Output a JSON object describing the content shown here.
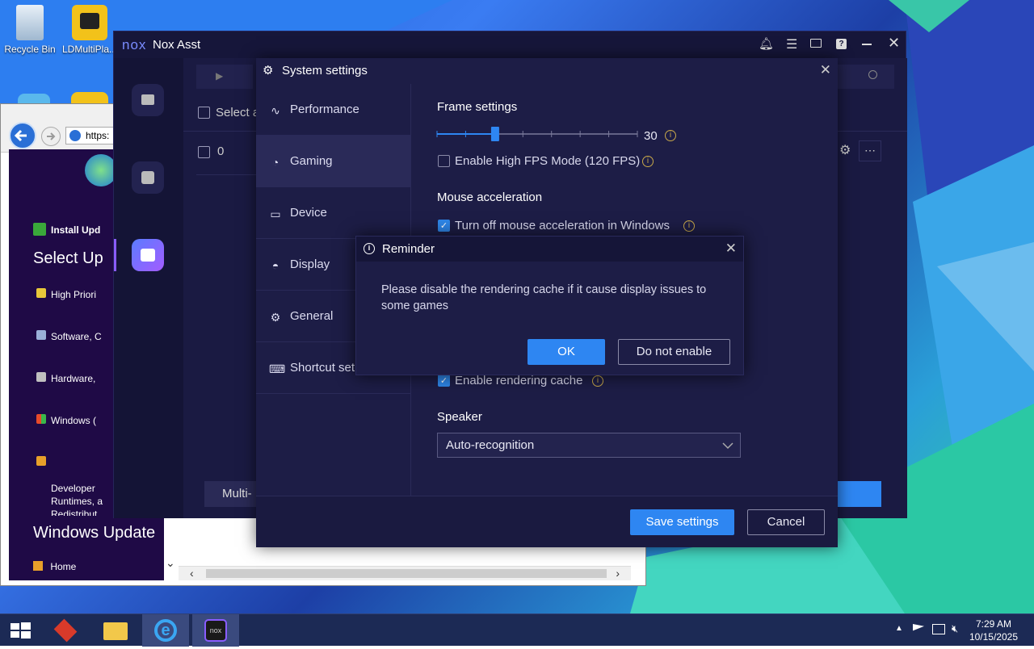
{
  "desktop": {
    "icons": [
      {
        "label": "Recycle Bin",
        "icon": "recycle-bin-icon"
      },
      {
        "label": "LDMultiPla...",
        "icon": "ldmultiplayer-icon"
      }
    ]
  },
  "ie": {
    "address": "https:",
    "update_panel": {
      "install_label": "Install Upd",
      "select_title": "Select Up",
      "items": [
        {
          "label": "High Priori",
          "icon": "shield-icon"
        },
        {
          "label": "Software, C",
          "icon": "software-icon"
        },
        {
          "label": "Hardware,",
          "icon": "hardware-icon"
        },
        {
          "label": "Windows (",
          "icon": "windows-icon"
        },
        {
          "label": "Developer\nRuntimes, a\nRedistribut",
          "icon": "developer-icon"
        }
      ],
      "windows_update_title": "Windows Update",
      "home_label": "Home"
    }
  },
  "nox": {
    "title": "Nox Asst",
    "logo_text": "nox",
    "select_all_label": "Select a",
    "row_value": "0",
    "multi_button_label": "Multi-",
    "colors": {
      "accent": "#2e86f2",
      "bg": "#16163a"
    }
  },
  "settings": {
    "title": "System settings",
    "nav": [
      {
        "label": "Performance",
        "icon": "pulse-icon",
        "active": false
      },
      {
        "label": "Gaming",
        "icon": "gamepad-icon",
        "active": true
      },
      {
        "label": "Device",
        "icon": "device-icon",
        "active": false
      },
      {
        "label": "Display",
        "icon": "display-icon",
        "active": false
      },
      {
        "label": "General",
        "icon": "gear-icon",
        "active": false
      },
      {
        "label": "Shortcut set",
        "icon": "keyboard-icon",
        "active": false
      }
    ],
    "frame": {
      "title": "Frame settings",
      "fps_value": "30",
      "slider_fraction": 0.29,
      "high_fps_label": "Enable High FPS Mode (120 FPS)",
      "high_fps_checked": false
    },
    "mouse": {
      "title": "Mouse acceleration",
      "turn_off_label": "Turn off mouse acceleration in Windows",
      "turn_off_checked": true
    },
    "rendering": {
      "label": "Enable rendering cache",
      "checked": true
    },
    "speaker": {
      "title": "Speaker",
      "selected": "Auto-recognition"
    },
    "save_label": "Save settings",
    "cancel_label": "Cancel"
  },
  "reminder": {
    "title": "Reminder",
    "message": "Please disable the rendering cache if it cause display issues to some games",
    "ok_label": "OK",
    "no_label": "Do not enable"
  },
  "taskbar": {
    "time": "7:29 AM",
    "date": "10/15/2025"
  }
}
